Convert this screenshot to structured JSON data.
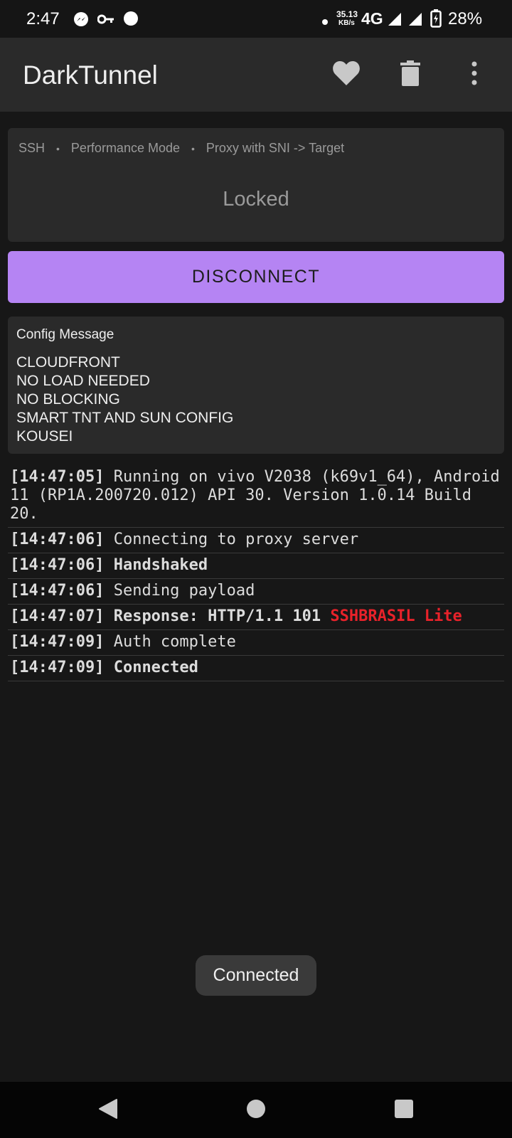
{
  "status_bar": {
    "time": "2:47",
    "left_icons": [
      "messenger-icon",
      "key-icon",
      "dot-icon"
    ],
    "speed_value": "35.13",
    "speed_unit": "KB/s",
    "network": "4G",
    "battery": "28%"
  },
  "app_bar": {
    "title": "DarkTunnel",
    "actions": [
      "heart-icon",
      "trash-icon",
      "more-vert-icon"
    ]
  },
  "config": {
    "tags": [
      "SSH",
      "Performance Mode",
      "Proxy with SNI -> Target"
    ],
    "separator": "•",
    "state": "Locked"
  },
  "disconnect_label": "DISCONNECT",
  "config_message": {
    "title": "Config Message",
    "lines": [
      "CLOUDFRONT",
      "NO LOAD NEEDED",
      "NO BLOCKING",
      "SMART TNT AND SUN CONFIG",
      "KOUSEI"
    ]
  },
  "log": [
    {
      "ts": "[14:47:05]",
      "msg": "Running on vivo V2038 (k69v1_64), Android 11 (RP1A.200720.012) API 30. Version 1.0.14 Build 20.",
      "bold": false,
      "extra": ""
    },
    {
      "ts": "[14:47:06]",
      "msg": "Connecting to proxy server",
      "bold": false,
      "extra": ""
    },
    {
      "ts": "[14:47:06]",
      "msg": "Handshaked",
      "bold": true,
      "extra": ""
    },
    {
      "ts": "[14:47:06]",
      "msg": "Sending payload",
      "bold": false,
      "extra": ""
    },
    {
      "ts": "[14:47:07]",
      "msg": "Response: HTTP/1.1 101",
      "bold": true,
      "extra": "SSHBRASIL Lite"
    },
    {
      "ts": "[14:47:09]",
      "msg": "Auth complete",
      "bold": false,
      "extra": ""
    },
    {
      "ts": "[14:47:09]",
      "msg": "Connected",
      "bold": true,
      "extra": ""
    }
  ],
  "toast": "Connected",
  "colors": {
    "accent": "#b584f3",
    "log_highlight": "#e8222a",
    "background": "#171717",
    "card": "#2a2a2a"
  },
  "nav_bar": [
    "back-icon",
    "home-icon",
    "recents-icon"
  ]
}
